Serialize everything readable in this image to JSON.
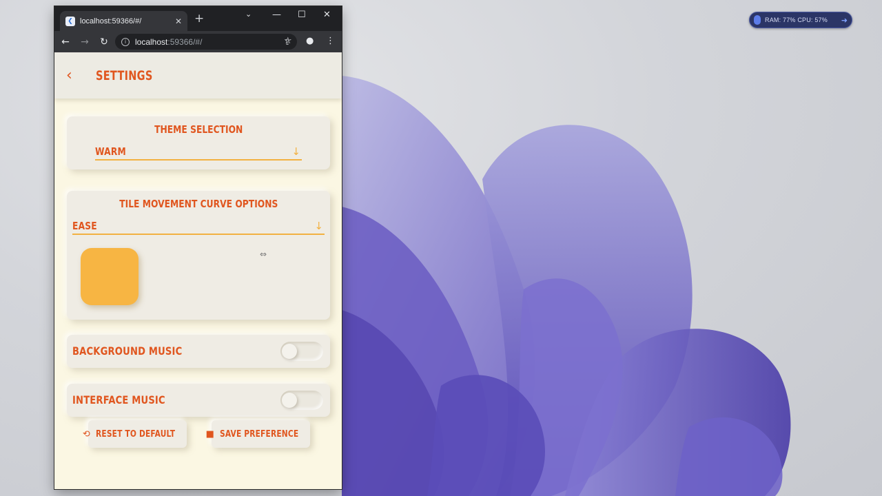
{
  "perf_widget": {
    "text": "RAM: 77%  CPU: 57%"
  },
  "browser": {
    "tab_title": "localhost:59366/#/",
    "url_host": "localhost",
    "url_rest": ":59366/#/"
  },
  "app": {
    "title": "SETTINGS",
    "theme_card": {
      "title": "THEME SELECTION",
      "selected": "WARM"
    },
    "curve_card": {
      "title": "TILE MOVEMENT CURVE OPTIONS",
      "selected": "EASE"
    },
    "background_music": {
      "label": "BACKGROUND MUSIC",
      "enabled": false
    },
    "interface_music": {
      "label": "INTERFACE MUSIC",
      "enabled": false
    },
    "reset_button": "RESET TO DEFAULT",
    "save_button": "SAVE PREFERENCE"
  },
  "colors": {
    "accent": "#e0561f",
    "tile": "#f7b543",
    "underline": "#f2b141",
    "background": "#fbf7e3"
  }
}
